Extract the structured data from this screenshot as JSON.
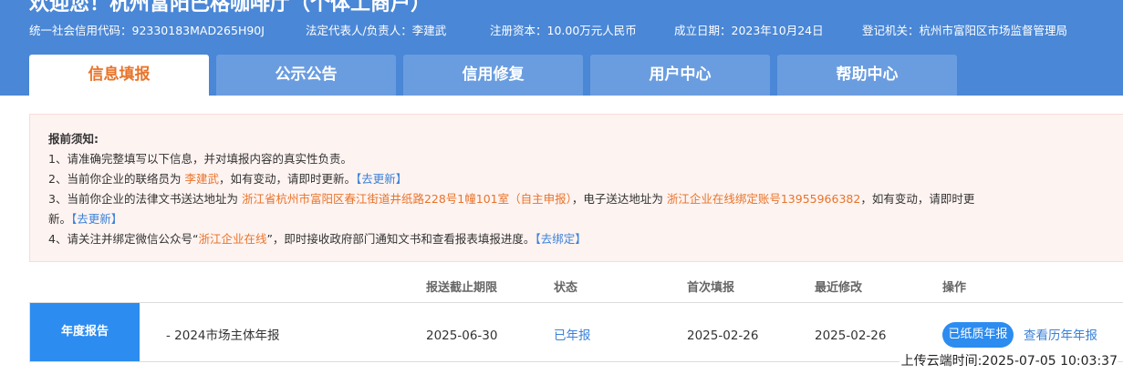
{
  "header": {
    "welcome": "欢迎您！杭州富阳巴格咖啡厅（个体工商户）",
    "credit_code": "统一社会信用代码：92330183MAD265H90J",
    "legal_rep": "法定代表人/负责人：李建武",
    "capital": "注册资本：10.00万元人民币",
    "established": "成立日期：2023年10月24日",
    "authority": "登记机关：杭州市富阳区市场监督管理局"
  },
  "tabs": [
    {
      "label": "信息填报",
      "active": true
    },
    {
      "label": "公示公告",
      "active": false
    },
    {
      "label": "信用修复",
      "active": false
    },
    {
      "label": "用户中心",
      "active": false
    },
    {
      "label": "帮助中心",
      "active": false
    }
  ],
  "notice": {
    "title": "报前须知:",
    "line1": "1、请准确完整填写以下信息，并对填报内容的真实性负责。",
    "line2_a": "2、当前你企业的联络员为 ",
    "line2_name": "李建武",
    "line2_b": "，如有变动，请即时更新。",
    "line2_link": "【去更新】",
    "line3_a": "3、当前你企业的法律文书送达地址为 ",
    "line3_addr": "浙江省杭州市富阳区春江街道井纸路228号1幢101室（自主申报）",
    "line3_b": "，电子送达地址为 ",
    "line3_eaddr": "浙江企业在线绑定账号13955966382",
    "line3_c": "，如有变动，请即时更",
    "line3_d": "新。",
    "line3_link": "【去更新】",
    "line4_a": "4、请关注并绑定微信公众号“",
    "line4_name": "浙江企业在线",
    "line4_b": "”，即时接收政府部门通知文书和查看报表填报进度。",
    "line4_link": "【去绑定】"
  },
  "table": {
    "headers": {
      "deadline": "报送截止期限",
      "status": "状态",
      "first": "首次填报",
      "modified": "最近修改",
      "action": "操作"
    },
    "row": {
      "label": "年度报告",
      "name": "- 2024市场主体年报",
      "deadline": "2025-06-30",
      "status": "已年报",
      "first": "2025-02-26",
      "modified": "2025-02-26",
      "btn_paper": "已纸质年报",
      "btn_history": "查看历年年报"
    }
  },
  "timestamp": "上传云端时间:2025-07-05 10:03:37",
  "colors": {
    "header_bg": "#4a87d6",
    "tab_bg": "#6a9de0",
    "accent_orange": "#e8742a",
    "link_blue": "#3b82d8",
    "button_blue": "#2c8cf0",
    "notice_bg": "#fdf3f1"
  }
}
